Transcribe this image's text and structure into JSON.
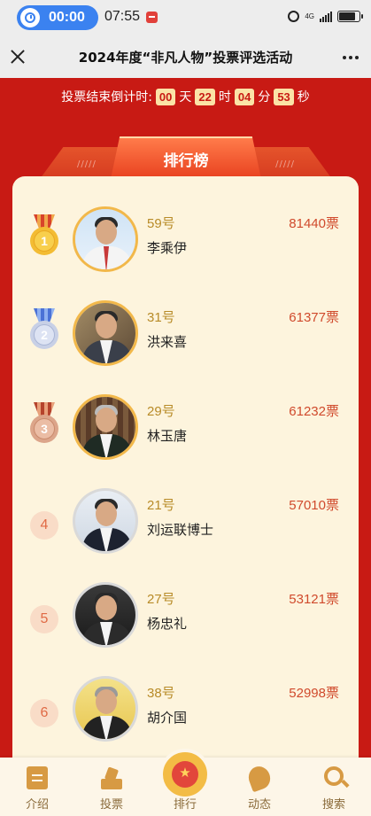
{
  "status_bar": {
    "call_timer": "00:00",
    "clock": "07:55",
    "network": "4G"
  },
  "nav": {
    "title": "2024年度“非凡人物”投票评选活动"
  },
  "countdown": {
    "label": "投票结束倒计时:",
    "days": "00",
    "days_unit": "天",
    "hours": "22",
    "hours_unit": "时",
    "minutes": "04",
    "minutes_unit": "分",
    "seconds": "53",
    "seconds_unit": "秒"
  },
  "ranking": {
    "tab_label": "排行榜",
    "tab_stripes": "/////",
    "items": [
      {
        "rank": "1",
        "number": "59号",
        "name": "李乘伊",
        "votes": "81440票",
        "medal": "gold"
      },
      {
        "rank": "2",
        "number": "31号",
        "name": "洪来喜",
        "votes": "61377票",
        "medal": "silver"
      },
      {
        "rank": "3",
        "number": "29号",
        "name": "林玉唐",
        "votes": "61232票",
        "medal": "bronze"
      },
      {
        "rank": "4",
        "number": "21号",
        "name": "刘运联博士",
        "votes": "57010票"
      },
      {
        "rank": "5",
        "number": "27号",
        "name": "杨忠礼",
        "votes": "53121票"
      },
      {
        "rank": "6",
        "number": "38号",
        "name": "胡介国",
        "votes": "52998票"
      }
    ]
  },
  "tabbar": {
    "items": [
      {
        "label": "介绍",
        "icon": "doc-icon"
      },
      {
        "label": "投票",
        "icon": "vote-icon"
      },
      {
        "label": "排行",
        "icon": "trophy-icon"
      },
      {
        "label": "动态",
        "icon": "leaf-icon"
      },
      {
        "label": "搜索",
        "icon": "search-icon"
      }
    ]
  },
  "colors": {
    "background": "#c81a14",
    "panel": "#fdf4dd",
    "accent": "#e8411f",
    "vote_text": "#d04a2c",
    "number_text": "#b88b28"
  }
}
